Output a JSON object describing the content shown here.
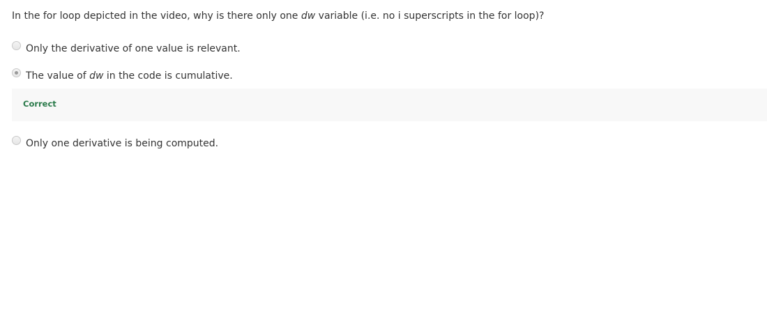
{
  "question": {
    "text_before": "In the for loop depicted in the video, why is there only one ",
    "math": "dw",
    "text_after": " variable (i.e. no i superscripts in the for loop)?"
  },
  "options": [
    {
      "label": "Only the derivative of one value is relevant.",
      "selected": false
    },
    {
      "label_before": "The value of ",
      "label_math": "dw",
      "label_after": " in the code is cumulative.",
      "selected": true
    },
    {
      "label": "Only one derivative is being computed.",
      "selected": false
    }
  ],
  "feedback": {
    "label": "Correct",
    "color": "#2a7a4a"
  }
}
